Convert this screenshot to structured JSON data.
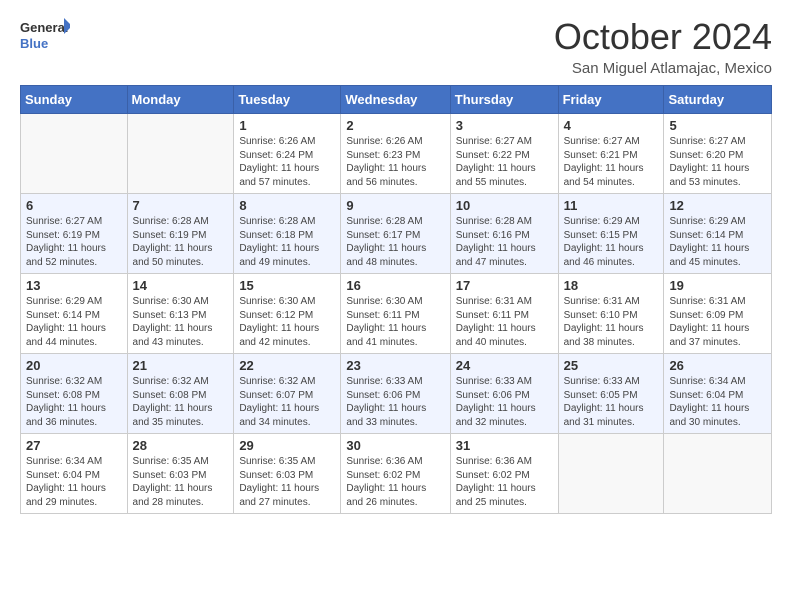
{
  "logo": {
    "line1": "General",
    "line2": "Blue"
  },
  "title": "October 2024",
  "location": "San Miguel Atlamajac, Mexico",
  "days_of_week": [
    "Sunday",
    "Monday",
    "Tuesday",
    "Wednesday",
    "Thursday",
    "Friday",
    "Saturday"
  ],
  "weeks": [
    [
      {
        "day": "",
        "sunrise": "",
        "sunset": "",
        "daylight": ""
      },
      {
        "day": "",
        "sunrise": "",
        "sunset": "",
        "daylight": ""
      },
      {
        "day": "1",
        "sunrise": "Sunrise: 6:26 AM",
        "sunset": "Sunset: 6:24 PM",
        "daylight": "Daylight: 11 hours and 57 minutes."
      },
      {
        "day": "2",
        "sunrise": "Sunrise: 6:26 AM",
        "sunset": "Sunset: 6:23 PM",
        "daylight": "Daylight: 11 hours and 56 minutes."
      },
      {
        "day": "3",
        "sunrise": "Sunrise: 6:27 AM",
        "sunset": "Sunset: 6:22 PM",
        "daylight": "Daylight: 11 hours and 55 minutes."
      },
      {
        "day": "4",
        "sunrise": "Sunrise: 6:27 AM",
        "sunset": "Sunset: 6:21 PM",
        "daylight": "Daylight: 11 hours and 54 minutes."
      },
      {
        "day": "5",
        "sunrise": "Sunrise: 6:27 AM",
        "sunset": "Sunset: 6:20 PM",
        "daylight": "Daylight: 11 hours and 53 minutes."
      }
    ],
    [
      {
        "day": "6",
        "sunrise": "Sunrise: 6:27 AM",
        "sunset": "Sunset: 6:19 PM",
        "daylight": "Daylight: 11 hours and 52 minutes."
      },
      {
        "day": "7",
        "sunrise": "Sunrise: 6:28 AM",
        "sunset": "Sunset: 6:19 PM",
        "daylight": "Daylight: 11 hours and 50 minutes."
      },
      {
        "day": "8",
        "sunrise": "Sunrise: 6:28 AM",
        "sunset": "Sunset: 6:18 PM",
        "daylight": "Daylight: 11 hours and 49 minutes."
      },
      {
        "day": "9",
        "sunrise": "Sunrise: 6:28 AM",
        "sunset": "Sunset: 6:17 PM",
        "daylight": "Daylight: 11 hours and 48 minutes."
      },
      {
        "day": "10",
        "sunrise": "Sunrise: 6:28 AM",
        "sunset": "Sunset: 6:16 PM",
        "daylight": "Daylight: 11 hours and 47 minutes."
      },
      {
        "day": "11",
        "sunrise": "Sunrise: 6:29 AM",
        "sunset": "Sunset: 6:15 PM",
        "daylight": "Daylight: 11 hours and 46 minutes."
      },
      {
        "day": "12",
        "sunrise": "Sunrise: 6:29 AM",
        "sunset": "Sunset: 6:14 PM",
        "daylight": "Daylight: 11 hours and 45 minutes."
      }
    ],
    [
      {
        "day": "13",
        "sunrise": "Sunrise: 6:29 AM",
        "sunset": "Sunset: 6:14 PM",
        "daylight": "Daylight: 11 hours and 44 minutes."
      },
      {
        "day": "14",
        "sunrise": "Sunrise: 6:30 AM",
        "sunset": "Sunset: 6:13 PM",
        "daylight": "Daylight: 11 hours and 43 minutes."
      },
      {
        "day": "15",
        "sunrise": "Sunrise: 6:30 AM",
        "sunset": "Sunset: 6:12 PM",
        "daylight": "Daylight: 11 hours and 42 minutes."
      },
      {
        "day": "16",
        "sunrise": "Sunrise: 6:30 AM",
        "sunset": "Sunset: 6:11 PM",
        "daylight": "Daylight: 11 hours and 41 minutes."
      },
      {
        "day": "17",
        "sunrise": "Sunrise: 6:31 AM",
        "sunset": "Sunset: 6:11 PM",
        "daylight": "Daylight: 11 hours and 40 minutes."
      },
      {
        "day": "18",
        "sunrise": "Sunrise: 6:31 AM",
        "sunset": "Sunset: 6:10 PM",
        "daylight": "Daylight: 11 hours and 38 minutes."
      },
      {
        "day": "19",
        "sunrise": "Sunrise: 6:31 AM",
        "sunset": "Sunset: 6:09 PM",
        "daylight": "Daylight: 11 hours and 37 minutes."
      }
    ],
    [
      {
        "day": "20",
        "sunrise": "Sunrise: 6:32 AM",
        "sunset": "Sunset: 6:08 PM",
        "daylight": "Daylight: 11 hours and 36 minutes."
      },
      {
        "day": "21",
        "sunrise": "Sunrise: 6:32 AM",
        "sunset": "Sunset: 6:08 PM",
        "daylight": "Daylight: 11 hours and 35 minutes."
      },
      {
        "day": "22",
        "sunrise": "Sunrise: 6:32 AM",
        "sunset": "Sunset: 6:07 PM",
        "daylight": "Daylight: 11 hours and 34 minutes."
      },
      {
        "day": "23",
        "sunrise": "Sunrise: 6:33 AM",
        "sunset": "Sunset: 6:06 PM",
        "daylight": "Daylight: 11 hours and 33 minutes."
      },
      {
        "day": "24",
        "sunrise": "Sunrise: 6:33 AM",
        "sunset": "Sunset: 6:06 PM",
        "daylight": "Daylight: 11 hours and 32 minutes."
      },
      {
        "day": "25",
        "sunrise": "Sunrise: 6:33 AM",
        "sunset": "Sunset: 6:05 PM",
        "daylight": "Daylight: 11 hours and 31 minutes."
      },
      {
        "day": "26",
        "sunrise": "Sunrise: 6:34 AM",
        "sunset": "Sunset: 6:04 PM",
        "daylight": "Daylight: 11 hours and 30 minutes."
      }
    ],
    [
      {
        "day": "27",
        "sunrise": "Sunrise: 6:34 AM",
        "sunset": "Sunset: 6:04 PM",
        "daylight": "Daylight: 11 hours and 29 minutes."
      },
      {
        "day": "28",
        "sunrise": "Sunrise: 6:35 AM",
        "sunset": "Sunset: 6:03 PM",
        "daylight": "Daylight: 11 hours and 28 minutes."
      },
      {
        "day": "29",
        "sunrise": "Sunrise: 6:35 AM",
        "sunset": "Sunset: 6:03 PM",
        "daylight": "Daylight: 11 hours and 27 minutes."
      },
      {
        "day": "30",
        "sunrise": "Sunrise: 6:36 AM",
        "sunset": "Sunset: 6:02 PM",
        "daylight": "Daylight: 11 hours and 26 minutes."
      },
      {
        "day": "31",
        "sunrise": "Sunrise: 6:36 AM",
        "sunset": "Sunset: 6:02 PM",
        "daylight": "Daylight: 11 hours and 25 minutes."
      },
      {
        "day": "",
        "sunrise": "",
        "sunset": "",
        "daylight": ""
      },
      {
        "day": "",
        "sunrise": "",
        "sunset": "",
        "daylight": ""
      }
    ]
  ]
}
